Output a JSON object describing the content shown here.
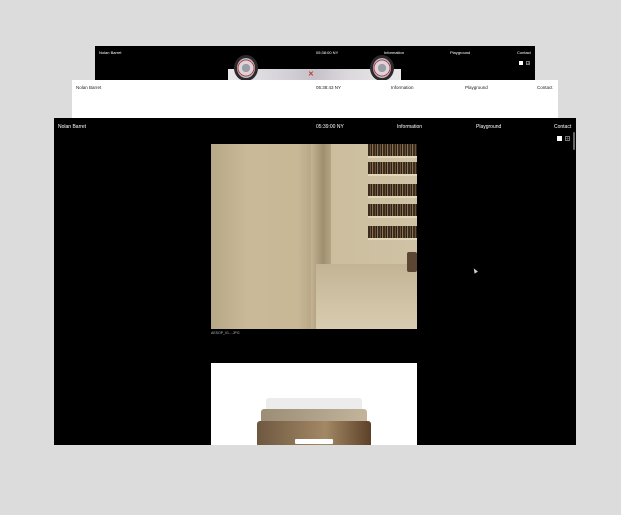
{
  "windows": {
    "back": {
      "nav": {
        "name": "Nolan Barret",
        "clock": "05:38:00 NY",
        "information": "Information",
        "playground": "Playground",
        "contact": "Contact"
      }
    },
    "middle": {
      "nav": {
        "name": "Nolan Barret",
        "clock": "05:38:43 NY",
        "information": "Information",
        "playground": "Playground",
        "contact": "Contact"
      }
    },
    "front": {
      "nav": {
        "name": "Nolan Barret",
        "clock": "05:39:00 NY",
        "information": "Information",
        "playground": "Playground",
        "contact": "Contact"
      },
      "image_caption": "AESOP_01....JPG"
    }
  },
  "icons": {
    "view_single": "single-view-icon",
    "view_grid": "grid-view-icon"
  },
  "colors": {
    "background": "#dcdcdc",
    "dark": "#000000",
    "light": "#ffffff"
  }
}
